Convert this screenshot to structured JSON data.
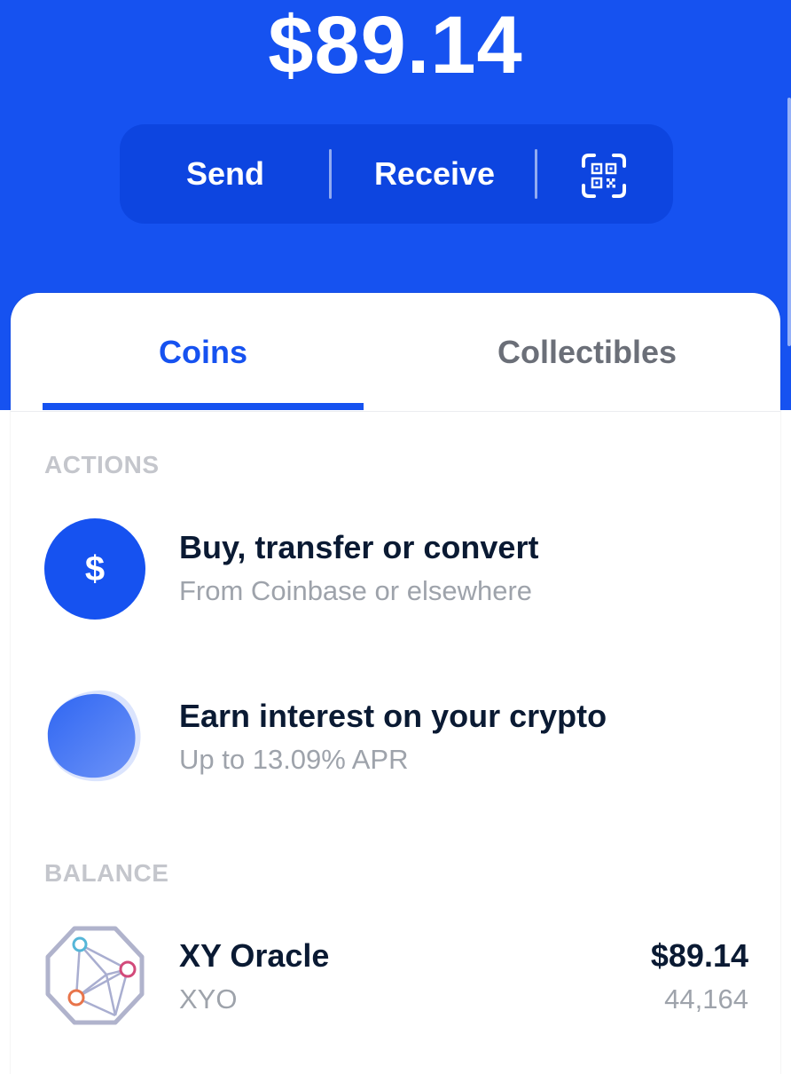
{
  "header": {
    "balance": "$89.14",
    "send_label": "Send",
    "receive_label": "Receive",
    "qr_icon": "qr-code-icon"
  },
  "tabs": [
    {
      "label": "Coins",
      "active": true
    },
    {
      "label": "Collectibles",
      "active": false
    }
  ],
  "actions": {
    "section_label": "ACTIONS",
    "items": [
      {
        "title": "Buy, transfer or convert",
        "subtitle": "From Coinbase or elsewhere",
        "icon_symbol": "$",
        "icon": "dollar-icon"
      },
      {
        "title": "Earn interest on your crypto",
        "subtitle": "Up to 13.09% APR",
        "icon": "earn-blob-icon"
      }
    ]
  },
  "balance_section": {
    "section_label": "BALANCE",
    "assets": [
      {
        "name": "XY Oracle",
        "ticker": "XYO",
        "value": "$89.14",
        "amount": "44,164",
        "icon": "xyo-logo-icon"
      }
    ]
  },
  "colors": {
    "brand_blue": "#1652f0",
    "pill_blue": "#0d45e0",
    "text_dark": "#0a1a33",
    "text_muted": "#9ea3ab",
    "section_label": "#c4c6cc"
  }
}
